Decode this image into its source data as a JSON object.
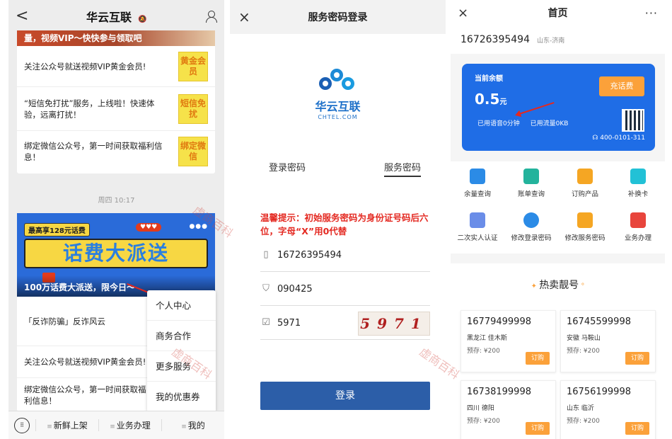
{
  "panel1": {
    "back": "<",
    "title": "华云互联",
    "title_muted": "🔕",
    "banner_top_text": "量，视频VIP～快快参与领取吧",
    "messages": [
      {
        "text": "关注公众号就送视频VIP黄金会员!",
        "thumb": "黄金会员"
      },
      {
        "text": "“短信免打扰”服务，上线啦！快速体验，远离打扰！",
        "thumb": "短信免扰"
      },
      {
        "text": "绑定微信公众号，第一时间获取福利信息！",
        "thumb": "绑定微信"
      }
    ],
    "timestamp": "周四 10:17",
    "banner2": {
      "tag": "最高享128元话费",
      "hearts": "♥♥♥",
      "main": "话费大派送",
      "caption": "100万话费大派送，限今日～"
    },
    "messages2": [
      "「反诈防骗」反诈风云",
      "关注公众号就送视频VIP黄金会员!",
      "绑定微信公众号，第一时间获取福利信息！"
    ],
    "popup_menu": [
      "个人中心",
      "商务合作",
      "更多服务",
      "我的优惠券"
    ],
    "bottom_tabs": [
      "新鲜上架",
      "业务办理",
      "我的"
    ]
  },
  "panel2": {
    "close": "×",
    "title": "服务密码登录",
    "logo_cn": "华云互联",
    "logo_en": "CHTEL.COM",
    "tabs": [
      "登录密码",
      "服务密码"
    ],
    "warning": "温馨提示：初始服务密码为身份证号码后六位，字母“X”用0代替",
    "phone": "16726395494",
    "password": "090425",
    "captcha_input": "5971",
    "captcha_image": "5971",
    "login_label": "登录"
  },
  "panel3": {
    "close": "×",
    "title": "首页",
    "more": "···",
    "phone": "16726395494",
    "location": "山东-济南",
    "balance_label": "当前余额",
    "balance_value": "0.5",
    "balance_unit": "元",
    "recharge": "充话费",
    "voice_usage": "已用语音0分钟",
    "data_usage": "已用流量0KB",
    "hotline": "400-0101-311",
    "services": [
      "余量查询",
      "账单查询",
      "订购产品",
      "补换卡",
      "二次实人认证",
      "修改登录密码",
      "修改服务密码",
      "业务办理"
    ],
    "hot_title": "热卖靓号",
    "numbers": [
      {
        "num": "16779499998",
        "loc": "黑龙江 佳木斯",
        "price": "预存: ¥200",
        "btn": "订购"
      },
      {
        "num": "16745599998",
        "loc": "安徽 马鞍山",
        "price": "预存: ¥200",
        "btn": "订购"
      },
      {
        "num": "16738199998",
        "loc": "四川 德阳",
        "price": "预存: ¥200",
        "btn": "订购"
      },
      {
        "num": "16756199998",
        "loc": "山东 临沂",
        "price": "预存: ¥200",
        "btn": "订购"
      }
    ],
    "colors": {
      "accent": "#1f6de6",
      "orange": "#fba13a"
    }
  },
  "watermark": "虚商百科"
}
